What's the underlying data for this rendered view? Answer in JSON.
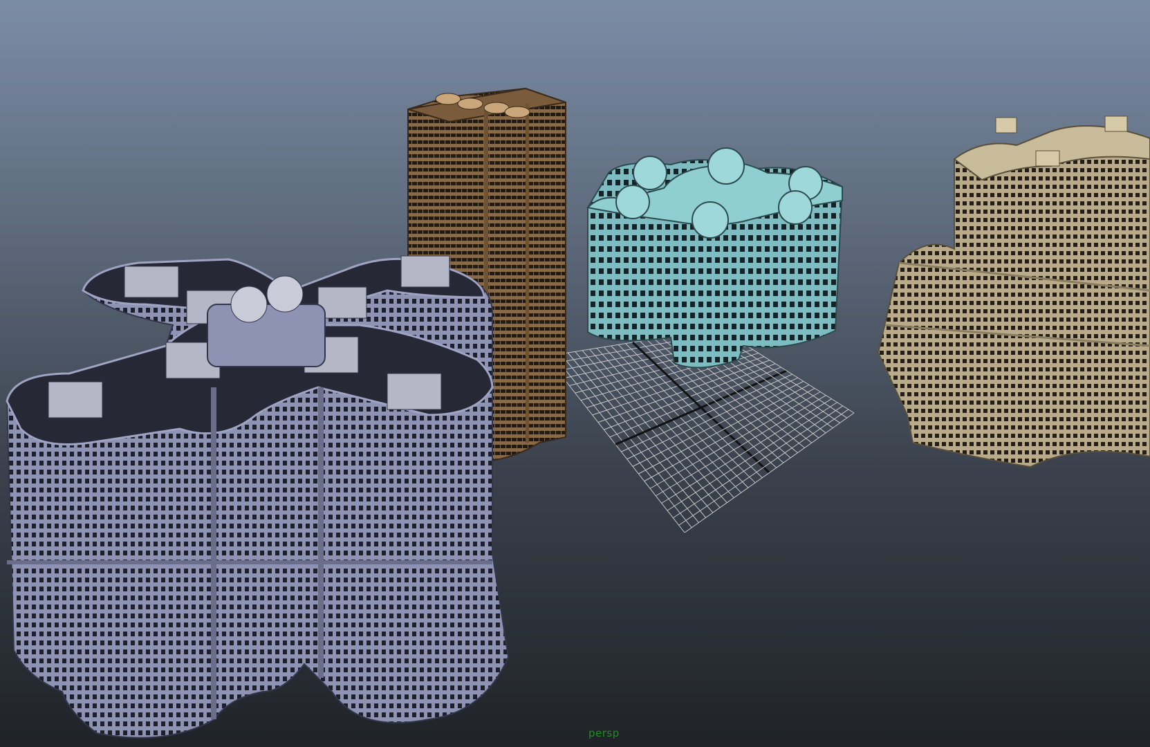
{
  "viewport": {
    "camera_name": "persp",
    "background_top": "#7b8ca5",
    "background_bottom": "#1f2328",
    "camera_label_color": "#1f8f1f"
  },
  "scene": {
    "objects": [
      {
        "name": "cross-shaped-office-building",
        "color": "#8e93b4"
      },
      {
        "name": "brown-tower-building",
        "color": "#8a6a46"
      },
      {
        "name": "cyan-star-shaped-building",
        "color": "#7dbcc0"
      },
      {
        "name": "beige-stepped-building",
        "color": "#b9ab8a"
      }
    ],
    "grid": {
      "visible": true,
      "color": "#c8c8c8"
    }
  }
}
